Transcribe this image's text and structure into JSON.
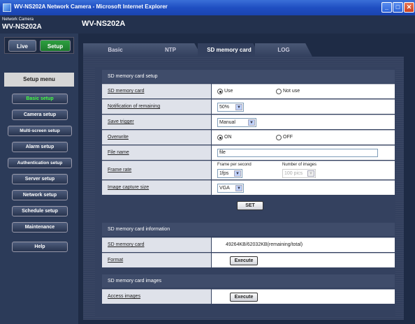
{
  "window": {
    "title": "WV-NS202A Network Camera - Microsoft Internet Explorer"
  },
  "header": {
    "small_label": "Network Camera",
    "model_small": "WV-NS202A",
    "model_large": "WV-NS202A"
  },
  "modes": {
    "live": "Live",
    "setup": "Setup"
  },
  "setup_menu": {
    "title": "Setup menu",
    "items": [
      "Basic setup",
      "Camera setup",
      "Multi-screen setup",
      "Alarm setup",
      "Authentication setup",
      "Server setup",
      "Network setup",
      "Schedule setup",
      "Maintenance",
      "Help"
    ],
    "active": "Basic setup"
  },
  "tabs": [
    "Basic",
    "NTP",
    "SD memory card",
    "LOG"
  ],
  "active_tab": "SD memory card",
  "sd_setup": {
    "section_title": "SD memory card setup",
    "labels": {
      "sd_card": "SD memory card",
      "notification": "Notification of remaining",
      "save_trigger": "Save trigger",
      "overwrite": "Overwrite",
      "file_name": "File name",
      "frame_rate": "Frame rate",
      "capture_size": "Image capture size"
    },
    "sd_use": "Use",
    "sd_not_use": "Not use",
    "notification_value": "50%",
    "save_trigger_value": "Manual",
    "overwrite_on": "ON",
    "overwrite_off": "OFF",
    "file_name_value": "file",
    "fps_label": "Frame per second",
    "fps_value": "1fps",
    "num_images_label": "Number of images",
    "num_images_value": "100 pics",
    "capture_size_value": "VGA",
    "set_button": "SET"
  },
  "sd_info": {
    "section_title": "SD memory card information",
    "card_label": "SD memory card",
    "card_value": "49264KB/62032KB(remaining/total)",
    "format_label": "Format",
    "execute": "Execute"
  },
  "sd_images": {
    "section_title": "SD memory card images",
    "access_label": "Access images",
    "execute": "Execute"
  }
}
